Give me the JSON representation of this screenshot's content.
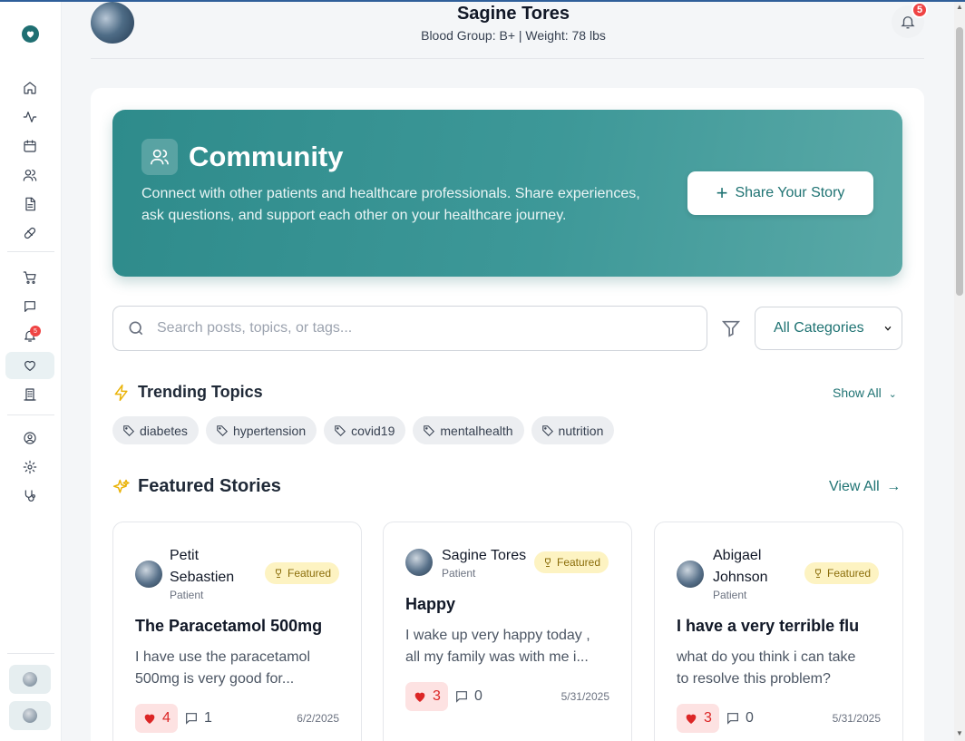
{
  "header": {
    "name": "Sagine Tores",
    "subtitle": "Blood Group: B+ | Weight: 78 lbs",
    "notification_count": "5"
  },
  "sidebar": {
    "items": [
      {
        "icon": "home-icon"
      },
      {
        "icon": "activity-icon"
      },
      {
        "icon": "calendar-icon"
      },
      {
        "icon": "users-icon"
      },
      {
        "icon": "file-icon"
      },
      {
        "icon": "pill-icon"
      },
      {
        "icon": "cart-icon"
      },
      {
        "icon": "message-icon"
      },
      {
        "icon": "bell-icon"
      },
      {
        "icon": "heart-icon"
      },
      {
        "icon": "building-icon"
      },
      {
        "icon": "user-circle-icon"
      },
      {
        "icon": "gear-icon"
      },
      {
        "icon": "stethoscope-icon"
      }
    ],
    "bell_badge": "5"
  },
  "hero": {
    "title": "Community",
    "description": "Connect with other patients and healthcare professionals. Share experiences, ask questions, and support each other on your healthcare journey.",
    "share_label": "Share Your Story"
  },
  "search": {
    "placeholder": "Search posts, topics, or tags...",
    "category_selected": "All Categories"
  },
  "trending": {
    "title": "Trending Topics",
    "show_all": "Show All",
    "tags": [
      "diabetes",
      "hypertension",
      "covid19",
      "mentalhealth",
      "nutrition"
    ]
  },
  "featured": {
    "title": "Featured Stories",
    "view_all": "View All",
    "badge_label": "Featured",
    "stories": [
      {
        "author_line1": "Petit",
        "author_line2": "Sebastien",
        "role": "Patient",
        "title": "The Paracetamol 500mg",
        "excerpt_line1": "I have use the paracetamol",
        "excerpt_line2": "500mg is very good for...",
        "likes": "4",
        "comments": "1",
        "date": "6/2/2025"
      },
      {
        "author_line1": "Sagine Tores",
        "author_line2": "",
        "role": "Patient",
        "title": "Happy",
        "excerpt_line1": "I wake up very happy today ,",
        "excerpt_line2": "all my family was with me i...",
        "likes": "3",
        "comments": "0",
        "date": "5/31/2025"
      },
      {
        "author_line1": "Abigael",
        "author_line2": "Johnson",
        "role": "Patient",
        "title": "I have a very terrible flu",
        "excerpt_line1": "what do you think i can take",
        "excerpt_line2": "to resolve this problem?",
        "likes": "3",
        "comments": "0",
        "date": "5/31/2025"
      }
    ]
  },
  "colors": {
    "accent": "#1f7373",
    "hero_bg": "#3d9898",
    "badge_red": "#ef4444",
    "featured_bg": "#fdf3c2"
  }
}
